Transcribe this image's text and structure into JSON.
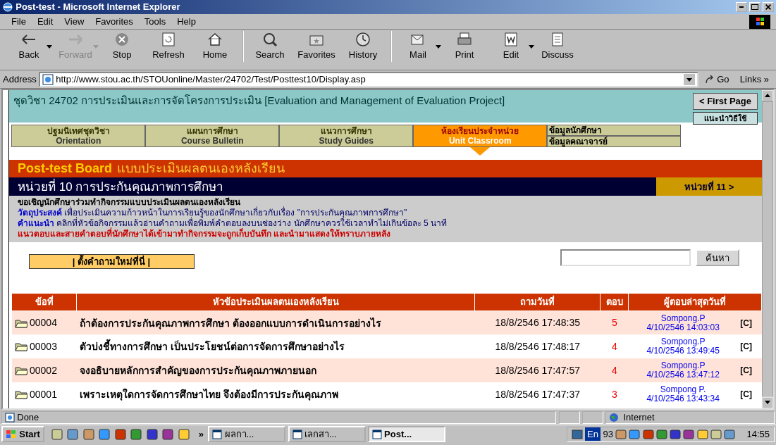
{
  "window": {
    "title": "Post-test - Microsoft Internet Explorer"
  },
  "menu": [
    "File",
    "Edit",
    "View",
    "Favorites",
    "Tools",
    "Help"
  ],
  "toolbar": [
    {
      "label": "Back",
      "disabled": false,
      "dropdown": true,
      "separator_before": false
    },
    {
      "label": "Forward",
      "disabled": true,
      "dropdown": true,
      "separator_before": false
    },
    {
      "label": "Stop",
      "disabled": false,
      "dropdown": false,
      "separator_before": false
    },
    {
      "label": "Refresh",
      "disabled": false,
      "dropdown": false,
      "separator_before": false
    },
    {
      "label": "Home",
      "disabled": false,
      "dropdown": false,
      "separator_before": false
    },
    {
      "label": "Search",
      "disabled": false,
      "dropdown": false,
      "separator_before": true
    },
    {
      "label": "Favorites",
      "disabled": false,
      "dropdown": false,
      "separator_before": false
    },
    {
      "label": "History",
      "disabled": false,
      "dropdown": false,
      "separator_before": false
    },
    {
      "label": "Mail",
      "disabled": false,
      "dropdown": true,
      "separator_before": true
    },
    {
      "label": "Print",
      "disabled": false,
      "dropdown": false,
      "separator_before": false
    },
    {
      "label": "Edit",
      "disabled": false,
      "dropdown": true,
      "separator_before": false
    },
    {
      "label": "Discuss",
      "disabled": false,
      "dropdown": false,
      "separator_before": false
    }
  ],
  "address": {
    "label": "Address",
    "url": "http://www.stou.ac.th/STOUonline/Master/24702/Test/Posttest10/Display.asp",
    "go": "Go",
    "links": "Links »"
  },
  "course": {
    "title": "ชุดวิชา 24702 การประเมินและการจัดโครงการประเมิน [Evaluation and Management of Evaluation Project]",
    "first_page": "< First Page",
    "help": "แนะนำวิธีใช้"
  },
  "nav_tabs": [
    {
      "thai": "ปฐมนิเทศชุดวิชา",
      "english": "Orientation",
      "selected": false
    },
    {
      "thai": "แผนการศึกษา",
      "english": "Course Bulletin",
      "selected": false
    },
    {
      "thai": "แนวการศึกษา",
      "english": "Study Guides",
      "selected": false
    },
    {
      "thai": "ห้องเรียนประจำหน่วย",
      "english": "Unit Classroom",
      "selected": true
    }
  ],
  "nav_links": [
    "ข้อมูลนักศึกษา",
    "ข้อมูลคณาจารย์"
  ],
  "board": {
    "title": "Post-test Board",
    "subtitle": "แบบประเมินผลตนเองหลังเรียน"
  },
  "unit": {
    "title": "หน่วยที่ 10 การประกันคุณภาพการศึกษา",
    "next": "หน่วยที่ 11 >"
  },
  "info": [
    {
      "kind": "intro",
      "text": "ขอเชิญนักศึกษาร่วมทำกิจกรรมแบบประเมินผลตนเองหลังเรียน"
    },
    {
      "kind": "labeled",
      "label": "วัตถุประสงค์",
      "text": "เพื่อประเมินความก้าวหน้าในการเรียนรู้ของนักศึกษาเกี่ยวกับเรื่อง \"การประกันคุณภาพการศึกษา\""
    },
    {
      "kind": "labeled",
      "label": "คำแนะนำ",
      "text": "คลิกที่หัวข้อกิจกรรมแล้วอ่านคำถามเพื่อพิมพ์คำตอบลงบนช่องว่าง นักศึกษาควรใช้เวลาทำไม่เกินข้อละ 5 นาที"
    },
    {
      "kind": "notice",
      "text": "แนวตอบและสายคำตอบที่นักศึกษาได้เข้ามาทำกิจกรรมจะถูกเก็บบันทึก และนำมาแสดงให้ทราบภายหลัง"
    }
  ],
  "new_question": "| ตั้งคำถามใหม่ที่นี่ |",
  "search": {
    "button": "ค้นหา"
  },
  "table": {
    "columns": [
      "ข้อที่",
      "หัวข้อประเมินผลตนเองหลังเรียน",
      "ถามวันที่",
      "ตอบ",
      "ผู้ตอบล่าสุดวันที่"
    ],
    "rows": [
      {
        "number": "00004",
        "topic": "ถ้าต้องการประกันคุณภาพการศึกษา ต้องออกแบบการดำเนินการอย่างไร",
        "asked": "18/8/2546 17:48:35",
        "replies": "5",
        "last_by": "Sompong.P",
        "last_date": "4/10/2546 14:03:03",
        "tag": "[C]"
      },
      {
        "number": "00003",
        "topic": "ตัวบ่งชี้ทางการศึกษา เป็นประโยชน์ต่อการจัดการศึกษาอย่างไร",
        "asked": "18/8/2546 17:48:17",
        "replies": "4",
        "last_by": "Sompong.P",
        "last_date": "4/10/2546 13:49:45",
        "tag": "[C]"
      },
      {
        "number": "00002",
        "topic": "จงอธิบายหลักการสำคัญของการประกันคุณภาพภายนอก",
        "asked": "18/8/2546 17:47:57",
        "replies": "4",
        "last_by": "Sompong.P",
        "last_date": "4/10/2546 13:47:12",
        "tag": "[C]"
      },
      {
        "number": "00001",
        "topic": "เพราะเหตุใดการจัดการศึกษาไทย จึงต้องมีการประกันคุณภาพ",
        "asked": "18/8/2546 17:47:37",
        "replies": "3",
        "last_by": "Sompong P.",
        "last_date": "4/10/2546 13:43:34",
        "tag": "[C]"
      }
    ]
  },
  "status_bar": {
    "text": "Done",
    "zone": "Internet"
  },
  "taskbar": {
    "start": "Start",
    "more": "»",
    "tasks": [
      {
        "label": "ผลกา...",
        "selected": false
      },
      {
        "label": "เลกสา...",
        "selected": false
      },
      {
        "label": "Post...",
        "selected": true
      }
    ],
    "lang": "En",
    "number": "93",
    "clock": "14:55"
  }
}
